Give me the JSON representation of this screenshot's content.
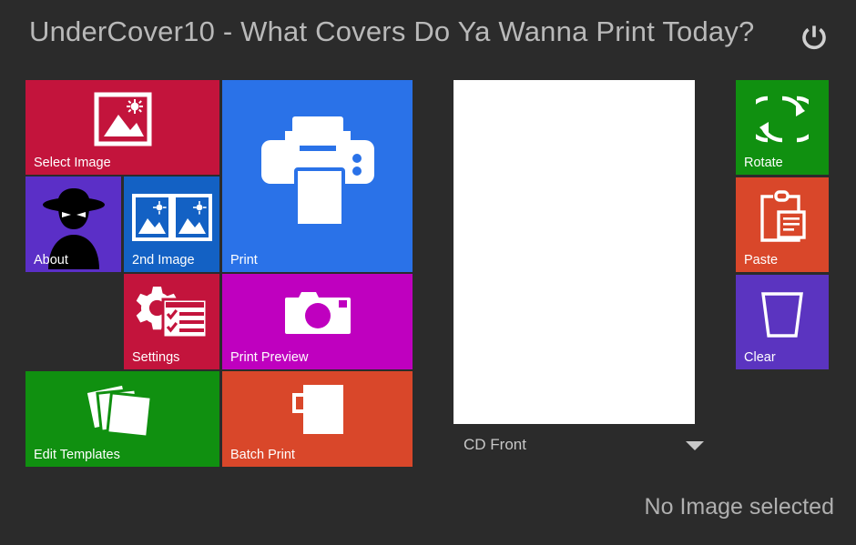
{
  "window": {
    "title": "UnderCover10 - What Covers Do Ya Wanna Print Today?",
    "background_color": "#2b2b2b",
    "title_color": "#b9b9b9",
    "power_icon": "power-icon"
  },
  "tiles": [
    {
      "id": "select-image",
      "label": "Select Image",
      "color": "#c3143c",
      "icon": "picture-icon"
    },
    {
      "id": "about",
      "label": "About",
      "color": "#5b2fc7",
      "icon": "spy-silhouette-icon"
    },
    {
      "id": "2nd-image",
      "label": "2nd Image",
      "color": "#1361c4",
      "icon": "two-pictures-icon"
    },
    {
      "id": "print",
      "label": "Print",
      "color": "#2a72e8",
      "icon": "printer-icon"
    },
    {
      "id": "settings",
      "label": "Settings",
      "color": "#c3143c",
      "icon": "gear-checklist-icon"
    },
    {
      "id": "print-preview",
      "label": "Print Preview",
      "color": "#bf00bf",
      "icon": "camera-icon"
    },
    {
      "id": "edit-templates",
      "label": "Edit Templates",
      "color": "#109010",
      "icon": "stacked-cards-icon"
    },
    {
      "id": "batch-print",
      "label": "Batch Print",
      "color": "#d9472a",
      "icon": "mug-icon"
    },
    {
      "id": "rotate",
      "label": "Rotate",
      "color": "#109010",
      "icon": "rotate-icon"
    },
    {
      "id": "paste",
      "label": "Paste",
      "color": "#d9472a",
      "icon": "clipboard-icon"
    },
    {
      "id": "clear",
      "label": "Clear",
      "color": "#5b34c0",
      "icon": "trash-bucket-icon"
    }
  ],
  "preview": {
    "background_color": "#ffffff",
    "content": ""
  },
  "template_select": {
    "value": "CD Front",
    "arrow_icon": "chevron-down-icon"
  },
  "status": {
    "message": "No Image selected"
  }
}
